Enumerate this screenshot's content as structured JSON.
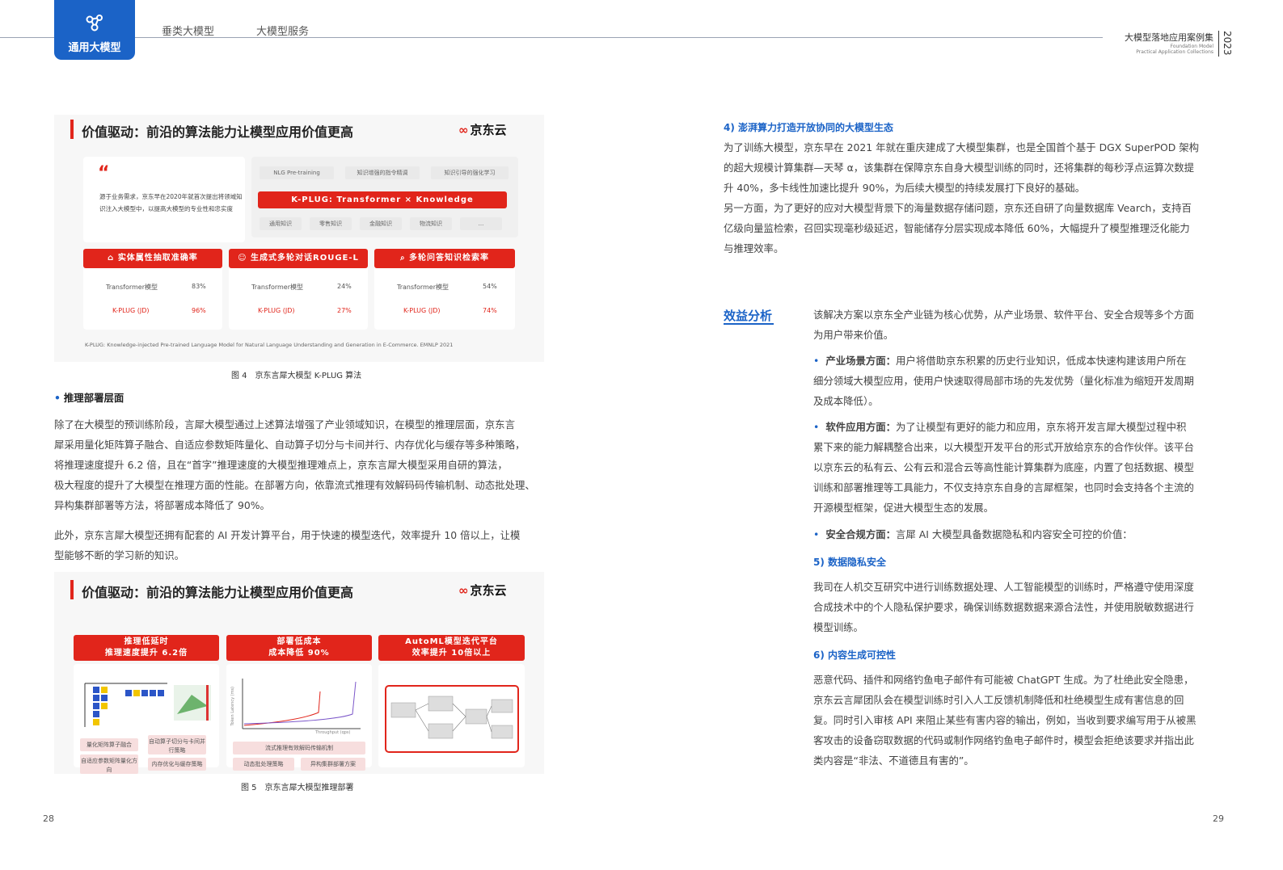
{
  "header": {
    "tab_active": "通用大模型",
    "tab2": "垂类大模型",
    "tab3": "大模型服务",
    "brand_cn": "大模型落地应用案例集",
    "brand_en1": "Foundation Model",
    "brand_en2": "Practical Application Collections",
    "year": "2023"
  },
  "fig4": {
    "title": "价值驱动：前沿的算法能力让模型应用价值更高",
    "logo": "京东云",
    "quote": "源于业务需求，京东早在2020年就首次提出将领域知识注入大模型中，以提高大模型的专业性和忠实度",
    "tags_top": [
      "NLG Pre-training",
      "知识增强的指令精调",
      "知识引导的强化学习"
    ],
    "kplug": "K-PLUG: Transformer × Knowledge",
    "tags_bottom": [
      "通用知识",
      "零售知识",
      "金融知识",
      "物流知识",
      "..."
    ],
    "cards": [
      {
        "title": "实体属性抽取准确率",
        "r1": "Transformer模型",
        "v1": "83%",
        "r2": "K-PLUG (JD)",
        "v2": "96%"
      },
      {
        "title": "生成式多轮对话ROUGE-L",
        "r1": "Transformer模型",
        "v1": "24%",
        "r2": "K-PLUG (JD)",
        "v2": "27%"
      },
      {
        "title": "多轮问答知识检索率",
        "r1": "Transformer模型",
        "v1": "54%",
        "r2": "K-PLUG (JD)",
        "v2": "74%"
      }
    ],
    "footnote": "K-PLUG: Knowledge-injected Pre-trained Language Model for Natural Language Understanding and Generation in E-Commerce. EMNLP 2021",
    "caption": "图 4　京东言犀大模型 K-PLUG 算法"
  },
  "left": {
    "bullet": "推理部署层面",
    "p1": [
      "除了在大模型的预训练阶段，言犀大模型通过上述算法增强了产业领域知识，在模型的推理层面，京东言",
      "犀采用量化矩阵算子融合、自适应参数矩阵量化、自动算子切分与卡间并行、内存优化与缓存等多种策略，",
      "将推理速度提升 6.2 倍，且在“首字”推理速度的大模型推理难点上，京东言犀大模型采用自研的算法，",
      "极大程度的提升了大模型在推理方面的性能。在部署方向，依靠流式推理有效解码码传输机制、动态批处理、",
      "异构集群部署等方法，将部署成本降低了 90%。"
    ],
    "p2": [
      "此外，京东言犀大模型还拥有配套的 AI 开发计算平台，用于快速的模型迭代，效率提升 10 倍以上，让模",
      "型能够不断的学习新的知识。"
    ]
  },
  "fig5": {
    "title": "价值驱动：前沿的算法能力让模型应用价值更高",
    "logo": "京东云",
    "bars": [
      {
        "l1": "推理低延时",
        "l2": "推理速度提升 6.2倍"
      },
      {
        "l1": "部署低成本",
        "l2": "成本降低 90%"
      },
      {
        "l1": "AutoML模型迭代平台",
        "l2": "效率提升 10倍以上"
      }
    ],
    "tags1": [
      "量化矩阵算子融合",
      "自动算子切分与卡间并行策略",
      "自适应参数矩阵量化方向",
      "内存优化与缓存策略"
    ],
    "tags2": [
      "流式推理有效解码传输机制",
      "动态批处理策略",
      "异构集群部署方案"
    ],
    "chart_ylabel": "Token Latency (ms)",
    "chart_xlabel": "Throughput (qps)",
    "caption": "图 5　京东言犀大模型推理部署"
  },
  "right": {
    "h4": "4) 澎湃算力打造开放协同的大模型生态",
    "p4": [
      "为了训练大模型，京东早在 2021 年就在重庆建成了大模型集群，也是全国首个基于 DGX SuperPOD 架构",
      "的超大规模计算集群—天琴 α，该集群在保障京东自身大模型训练的同时，还将集群的每秒浮点运算次数提",
      "升 40%，多卡线性加速比提升 90%，为后续大模型的持续发展打下良好的基础。",
      "另一方面，为了更好的应对大模型背景下的海量数据存储问题，京东还自研了向量数据库 Vearch，支持百",
      "亿级向量监检索，召回实现毫秒级延迟，智能储存分层实现成本降低 60%，大幅提升了模型推理泛化能力",
      "与推理效率。"
    ],
    "section": "效益分析",
    "intro": [
      "该解决方案以京东全产业链为核心优势，从产业场景、软件平台、安全合规等多个方面",
      "为用户带来价值。"
    ],
    "b1_head": "产业场景方面：",
    "b1": [
      "用户将借助京东积累的历史行业知识，低成本快速构建该用户所在",
      "细分领域大模型应用，使用户快速取得局部市场的先发优势（量化标准为缩短开发周期",
      "及成本降低）。"
    ],
    "b2_head": "软件应用方面：",
    "b2": [
      "为了让模型有更好的能力和应用，京东将开发言犀大模型过程中积",
      "累下来的能力解耦整合出来，以大模型开发平台的形式开放给京东的合作伙伴。该平台",
      "以京东云的私有云、公有云和混合云等高性能计算集群为底座，内置了包括数据、模型",
      "训练和部署推理等工具能力，不仅支持京东自身的言犀框架，也同时会支持各个主流的",
      "开源模型框架，促进大模型生态的发展。"
    ],
    "b3_head": "安全合规方面：",
    "b3": "言犀 AI 大模型具备数据隐私和内容安全可控的价值：",
    "h5": "5) 数据隐私安全",
    "p5": [
      "我司在人机交互研究中进行训练数据处理、人工智能模型的训练时，严格遵守使用深度",
      "合成技术中的个人隐私保护要求，确保训练数据数据来源合法性，并使用脱敏数据进行",
      "模型训练。"
    ],
    "h6": "6) 内容生成可控性",
    "p6": [
      "恶意代码、插件和网络钓鱼电子邮件有可能被 ChatGPT 生成。为了杜绝此安全隐患，",
      "京东云言犀团队会在模型训练时引入人工反馈机制降低和杜绝模型生成有害信息的回",
      "复。同时引入审核 API 来阻止某些有害内容的输出，例如，当收到要求编写用于从被黑",
      "客攻击的设备窃取数据的代码或制作网络钓鱼电子邮件时，模型会拒绝该要求并指出此",
      "类内容是“非法、不道德且有害的”。"
    ]
  },
  "pages": {
    "left": "28",
    "right": "29"
  }
}
